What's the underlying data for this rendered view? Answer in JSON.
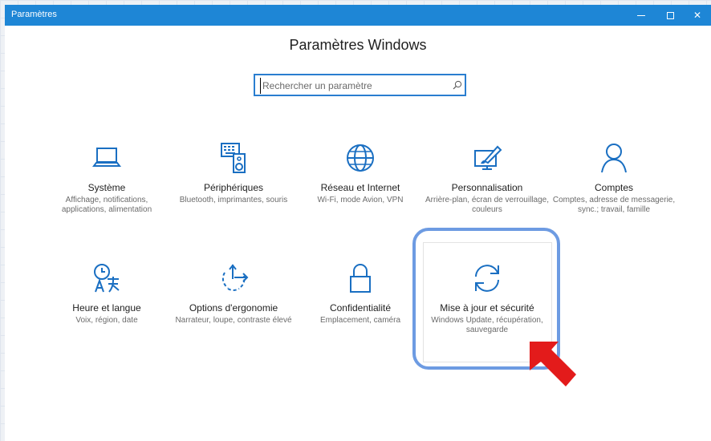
{
  "window": {
    "title": "Paramètres"
  },
  "header": {
    "title": "Paramètres Windows"
  },
  "search": {
    "placeholder": "Rechercher un paramètre"
  },
  "tiles": [
    {
      "name": "Système",
      "desc": "Affichage, notifications, applications, alimentation",
      "icon": "laptop-icon"
    },
    {
      "name": "Périphériques",
      "desc": "Bluetooth, imprimantes, souris",
      "icon": "keyboard-speaker-icon"
    },
    {
      "name": "Réseau et Internet",
      "desc": "Wi-Fi, mode Avion, VPN",
      "icon": "globe-icon"
    },
    {
      "name": "Personnalisation",
      "desc": "Arrière-plan, écran de verrouillage, couleurs",
      "icon": "paint-brush-icon"
    },
    {
      "name": "Comptes",
      "desc": "Comptes, adresse de messagerie, sync.; travail, famille",
      "icon": "person-icon"
    },
    {
      "name": "Heure et langue",
      "desc": "Voix, région, date",
      "icon": "time-language-icon"
    },
    {
      "name": "Options d'ergonomie",
      "desc": "Narrateur, loupe, contraste élevé",
      "icon": "ease-of-access-icon"
    },
    {
      "name": "Confidentialité",
      "desc": "Emplacement, caméra",
      "icon": "lock-icon"
    },
    {
      "name": "Mise à jour et sécurité",
      "desc": "Windows Update, récupération, sauvegarde",
      "icon": "sync-icon"
    }
  ],
  "colors": {
    "accent": "#1e86d6",
    "highlight": "#6d9be2",
    "arrow": "#e31b1b"
  }
}
